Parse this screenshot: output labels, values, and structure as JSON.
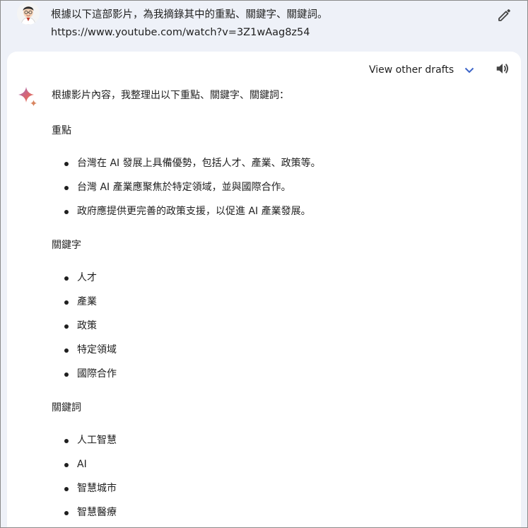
{
  "prompt": {
    "line1": "根據以下這部影片，為我摘錄其中的重點、關鍵字、關鍵詞。",
    "line2": "https://www.youtube.com/watch?v=3Z1wAag8z54"
  },
  "response": {
    "view_drafts_label": "View other drafts",
    "intro": "根據影片內容，我整理出以下重點、關鍵字、關鍵詞：",
    "sections": [
      {
        "title": "重點",
        "items": [
          "台灣在 AI 發展上具備優勢，包括人才、產業、政策等。",
          "台灣 AI 產業應聚焦於特定領域，並與國際合作。",
          "政府應提供更完善的政策支援，以促進 AI 產業發展。"
        ]
      },
      {
        "title": "關鍵字",
        "items": [
          "人才",
          "產業",
          "政策",
          "特定領域",
          "國際合作"
        ]
      },
      {
        "title": "關鍵詞",
        "items": [
          "人工智慧",
          "AI",
          "智慧城市",
          "智慧醫療"
        ]
      }
    ]
  },
  "icons": {
    "edit": "pencil-icon",
    "drafts": "chevron-down-icon",
    "speaker": "speaker-icon",
    "assistant": "sparkle-icon",
    "user": "avatar"
  },
  "colors": {
    "background": "#eef1f8",
    "card": "#ffffff",
    "text": "#1f1f1f",
    "accent_blue": "#3c64c8"
  }
}
